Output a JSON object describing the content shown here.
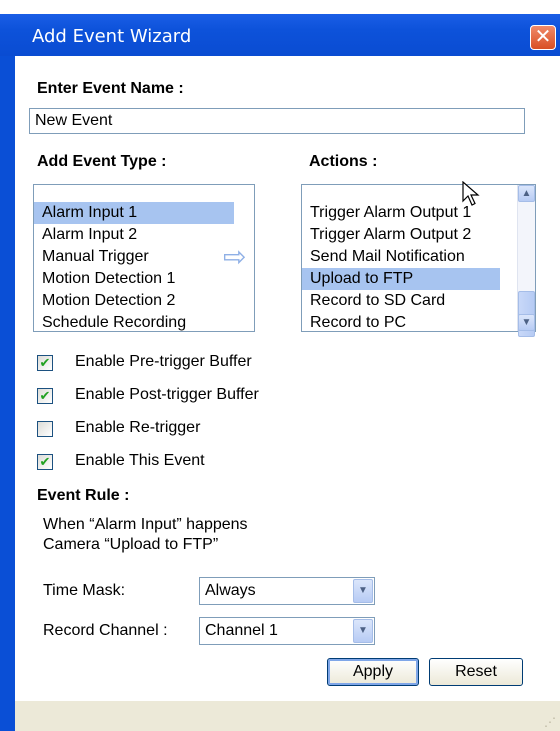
{
  "window": {
    "title": "Add Event Wizard",
    "close_glyph": "✕"
  },
  "event_name": {
    "label": "Enter Event Name :",
    "value": "New Event"
  },
  "event_type": {
    "label": "Add Event Type :",
    "items": [
      "Alarm Input 1",
      "Alarm Input 2",
      "Manual Trigger",
      "Motion Detection 1",
      "Motion Detection 2",
      "Schedule Recording"
    ],
    "selected_index": 0
  },
  "arrow_glyph": "⇨",
  "actions": {
    "label": "Actions :",
    "items": [
      "Trigger Alarm Output 1",
      "Trigger Alarm Output 2",
      "Send Mail Notification",
      "Upload to FTP",
      "Record to SD Card",
      "Record to PC"
    ],
    "selected_index": 3
  },
  "checkboxes": [
    {
      "label": "Enable Pre-trigger Buffer",
      "checked": true
    },
    {
      "label": "Enable Post-trigger Buffer",
      "checked": true
    },
    {
      "label": "Enable Re-trigger",
      "checked": false
    },
    {
      "label": "Enable This Event",
      "checked": true
    }
  ],
  "event_rule": {
    "label": "Event Rule :",
    "line1": "When  “Alarm Input”  happens",
    "line2": "Camera  “Upload to FTP”"
  },
  "time_mask": {
    "label": "Time Mask:",
    "value": "Always"
  },
  "record_channel": {
    "label": "Record Channel :",
    "value": "Channel 1"
  },
  "buttons": {
    "apply": "Apply",
    "reset": "Reset"
  },
  "icons": {
    "check": "✔",
    "scroll_up": "▲",
    "scroll_down": "▼",
    "dropdown": "▼",
    "grip": "⋰"
  },
  "colors": {
    "titlebar": "#0a4cd2",
    "selection": "#a7c4f0",
    "check": "#21a121"
  }
}
